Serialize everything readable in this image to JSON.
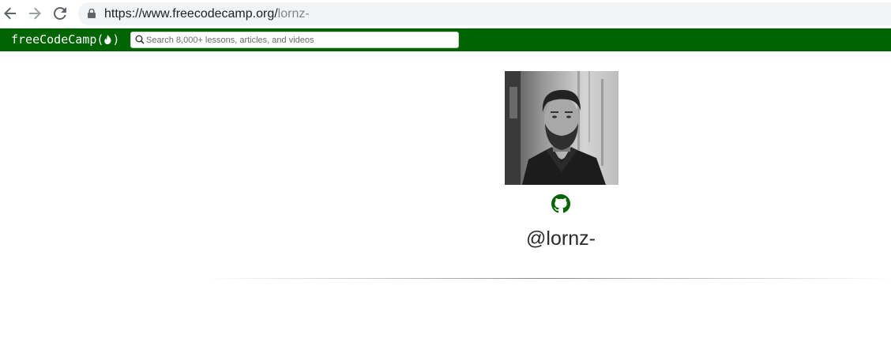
{
  "browser": {
    "url_host": "https://www.freecodecamp.org/",
    "url_path": "lornz-",
    "back_icon": "arrow-left-icon",
    "forward_icon": "arrow-right-icon",
    "reload_icon": "reload-icon",
    "lock_icon": "lock-icon"
  },
  "navbar": {
    "logo_prefix": "freeCodeCamp(",
    "logo_suffix": ")",
    "logo_icon": "flame-icon",
    "search_placeholder": "Search 8,000+ lessons, articles, and videos",
    "search_icon": "search-icon",
    "background_color": "#006400"
  },
  "profile": {
    "username": "@lornz-",
    "avatar_description": "avatar",
    "social_icon": "github-icon",
    "accent_color": "#006400"
  }
}
